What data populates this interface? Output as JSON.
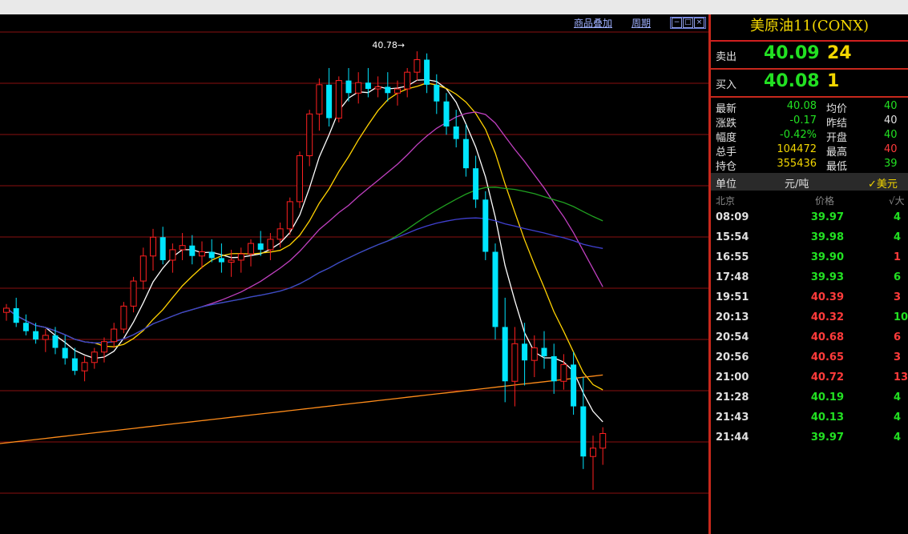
{
  "toolbar": {
    "overlay_label": "商品叠加",
    "period_label": "周期",
    "window_btns": [
      "−",
      "□",
      "×"
    ]
  },
  "chart": {
    "peak_label": "40.78→",
    "colors": {
      "up": "#ff2020",
      "down": "#00e5ff",
      "ma5": "#ffffff",
      "ma10": "#ffd200",
      "ma20": "#c040c0",
      "ma40": "#20a020",
      "ma60": "#4040d0",
      "ma_long": "#ff8c1a",
      "grid": "#8a1010"
    }
  },
  "chart_data": {
    "type": "candlestick",
    "candles": [
      [
        40.55,
        40.59,
        40.51,
        40.57
      ],
      [
        40.57,
        40.62,
        40.48,
        40.5
      ],
      [
        40.5,
        40.54,
        40.44,
        40.46
      ],
      [
        40.46,
        40.5,
        40.4,
        40.42
      ],
      [
        40.42,
        40.47,
        40.36,
        40.44
      ],
      [
        40.44,
        40.48,
        40.35,
        40.38
      ],
      [
        40.38,
        40.44,
        40.3,
        40.33
      ],
      [
        40.33,
        40.38,
        40.25,
        40.27
      ],
      [
        40.27,
        40.34,
        40.22,
        40.31
      ],
      [
        40.31,
        40.38,
        40.28,
        40.36
      ],
      [
        40.36,
        40.43,
        40.31,
        40.41
      ],
      [
        40.41,
        40.5,
        40.38,
        40.47
      ],
      [
        40.47,
        40.6,
        40.45,
        40.58
      ],
      [
        40.58,
        40.72,
        40.55,
        40.7
      ],
      [
        40.7,
        40.86,
        40.66,
        40.82
      ],
      [
        40.82,
        40.95,
        40.75,
        40.91
      ],
      [
        40.91,
        40.96,
        40.78,
        40.8
      ],
      [
        40.8,
        40.88,
        40.74,
        40.85
      ],
      [
        40.85,
        40.93,
        40.8,
        40.87
      ],
      [
        40.87,
        40.92,
        40.78,
        40.82
      ],
      [
        40.82,
        40.89,
        40.76,
        40.84
      ],
      [
        40.84,
        40.9,
        40.79,
        40.81
      ],
      [
        40.81,
        40.88,
        40.74,
        40.79
      ],
      [
        40.79,
        40.85,
        40.72,
        40.8
      ],
      [
        40.8,
        40.86,
        40.74,
        40.83
      ],
      [
        40.83,
        40.9,
        40.77,
        40.88
      ],
      [
        40.88,
        40.94,
        40.82,
        40.85
      ],
      [
        40.85,
        40.93,
        40.8,
        40.9
      ],
      [
        40.9,
        40.98,
        40.86,
        40.95
      ],
      [
        40.95,
        41.1,
        40.92,
        41.08
      ],
      [
        41.08,
        41.32,
        41.05,
        41.3
      ],
      [
        41.3,
        41.52,
        41.25,
        41.5
      ],
      [
        41.5,
        41.67,
        41.42,
        41.64
      ],
      [
        41.64,
        41.72,
        41.44,
        41.48
      ],
      [
        41.48,
        41.68,
        41.46,
        41.66
      ],
      [
        41.66,
        41.72,
        41.56,
        41.6
      ],
      [
        41.6,
        41.7,
        41.55,
        41.65
      ],
      [
        41.65,
        41.72,
        41.58,
        41.62
      ],
      [
        41.62,
        41.68,
        41.58,
        41.63
      ],
      [
        41.63,
        41.7,
        41.56,
        41.6
      ],
      [
        41.6,
        41.66,
        41.54,
        41.62
      ],
      [
        41.62,
        41.72,
        41.58,
        41.7
      ],
      [
        41.7,
        41.8,
        41.66,
        41.76
      ],
      [
        41.76,
        41.79,
        41.6,
        41.64
      ],
      [
        41.64,
        41.69,
        41.5,
        41.56
      ],
      [
        41.56,
        41.6,
        41.4,
        41.44
      ],
      [
        41.44,
        41.52,
        41.34,
        41.38
      ],
      [
        41.38,
        41.45,
        41.2,
        41.24
      ],
      [
        41.24,
        41.3,
        41.05,
        41.09
      ],
      [
        41.09,
        41.13,
        40.8,
        40.84
      ],
      [
        40.84,
        40.88,
        40.42,
        40.48
      ],
      [
        40.48,
        40.62,
        40.12,
        40.22
      ],
      [
        40.22,
        40.48,
        40.1,
        40.4
      ],
      [
        40.4,
        40.5,
        40.2,
        40.32
      ],
      [
        40.32,
        40.44,
        40.24,
        40.38
      ],
      [
        40.38,
        40.46,
        40.28,
        40.34
      ],
      [
        40.34,
        40.4,
        40.16,
        40.22
      ],
      [
        40.22,
        40.35,
        40.18,
        40.3
      ],
      [
        40.3,
        40.36,
        40.06,
        40.1
      ],
      [
        40.1,
        40.24,
        39.8,
        39.86
      ],
      [
        39.86,
        39.96,
        39.7,
        39.9
      ],
      [
        39.9,
        40.0,
        39.82,
        39.97
      ]
    ],
    "ylim": [
      39.6,
      41.9
    ],
    "peak": 40.78
  },
  "panel": {
    "title": "美原油11(CONX)",
    "sell": {
      "label": "卖出",
      "price": "40.09",
      "volume": "24"
    },
    "buy": {
      "label": "买入",
      "price": "40.08",
      "volume": "1"
    },
    "stats": [
      {
        "l1": "最新",
        "v1": "40.08",
        "c1": "g",
        "l2": "均价",
        "v2": "40",
        "c2": "g"
      },
      {
        "l1": "涨跌",
        "v1": "-0.17",
        "c1": "g",
        "l2": "昨结",
        "v2": "40",
        "c2": "w"
      },
      {
        "l1": "幅度",
        "v1": "-0.42%",
        "c1": "g",
        "l2": "开盘",
        "v2": "40",
        "c2": "g"
      },
      {
        "l1": "总手",
        "v1": "104472",
        "c1": "y",
        "l2": "最高",
        "v2": "40",
        "c2": "r"
      },
      {
        "l1": "持仓",
        "v1": "355436",
        "c1": "y",
        "l2": "最低",
        "v2": "39",
        "c2": "g"
      }
    ],
    "unit_label": "单位",
    "unit_value": "元/吨",
    "currency": "✓美元",
    "headers": {
      "time": "北京",
      "price": "价格",
      "vol": "√大"
    },
    "ticks": [
      {
        "time": "08:09",
        "price": "39.97",
        "pc": "g",
        "vol": "4",
        "vc": "g"
      },
      {
        "time": "15:54",
        "price": "39.98",
        "pc": "g",
        "vol": "4",
        "vc": "g"
      },
      {
        "time": "16:55",
        "price": "39.90",
        "pc": "g",
        "vol": "1",
        "vc": "r"
      },
      {
        "time": "17:48",
        "price": "39.93",
        "pc": "g",
        "vol": "6",
        "vc": "g"
      },
      {
        "time": "19:51",
        "price": "40.39",
        "pc": "r",
        "vol": "3",
        "vc": "r"
      },
      {
        "time": "20:13",
        "price": "40.32",
        "pc": "r",
        "vol": "10",
        "vc": "g"
      },
      {
        "time": "20:54",
        "price": "40.68",
        "pc": "r",
        "vol": "6",
        "vc": "r"
      },
      {
        "time": "20:56",
        "price": "40.65",
        "pc": "r",
        "vol": "3",
        "vc": "r"
      },
      {
        "time": "21:00",
        "price": "40.72",
        "pc": "r",
        "vol": "13",
        "vc": "r"
      },
      {
        "time": "21:28",
        "price": "40.19",
        "pc": "g",
        "vol": "4",
        "vc": "g"
      },
      {
        "time": "21:43",
        "price": "40.13",
        "pc": "g",
        "vol": "4",
        "vc": "g"
      },
      {
        "time": "21:44",
        "price": "39.97",
        "pc": "g",
        "vol": "4",
        "vc": "g"
      }
    ]
  }
}
